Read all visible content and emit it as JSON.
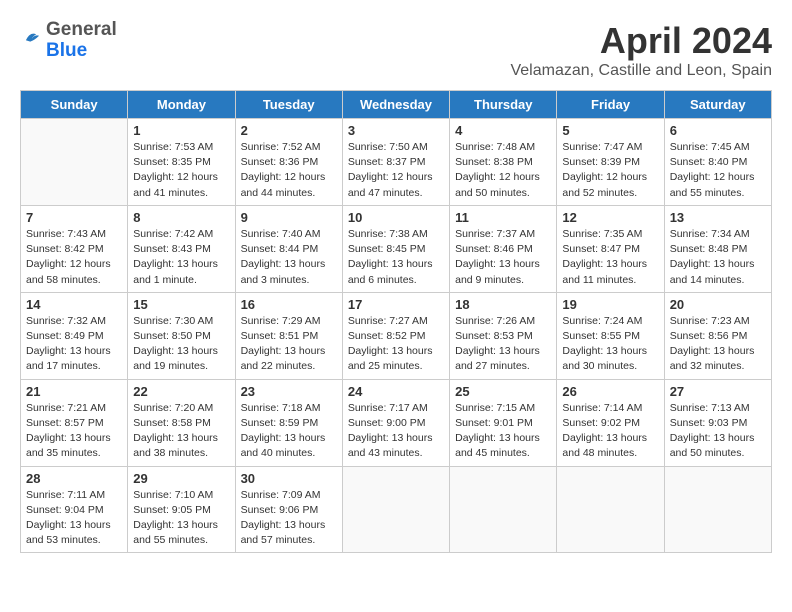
{
  "header": {
    "logo": {
      "general": "General",
      "blue": "Blue",
      "tagline": ""
    },
    "title": "April 2024",
    "subtitle": "Velamazan, Castille and Leon, Spain"
  },
  "calendar": {
    "weekdays": [
      "Sunday",
      "Monday",
      "Tuesday",
      "Wednesday",
      "Thursday",
      "Friday",
      "Saturday"
    ],
    "weeks": [
      [
        {
          "day": "",
          "info": ""
        },
        {
          "day": "1",
          "info": "Sunrise: 7:53 AM\nSunset: 8:35 PM\nDaylight: 12 hours\nand 41 minutes."
        },
        {
          "day": "2",
          "info": "Sunrise: 7:52 AM\nSunset: 8:36 PM\nDaylight: 12 hours\nand 44 minutes."
        },
        {
          "day": "3",
          "info": "Sunrise: 7:50 AM\nSunset: 8:37 PM\nDaylight: 12 hours\nand 47 minutes."
        },
        {
          "day": "4",
          "info": "Sunrise: 7:48 AM\nSunset: 8:38 PM\nDaylight: 12 hours\nand 50 minutes."
        },
        {
          "day": "5",
          "info": "Sunrise: 7:47 AM\nSunset: 8:39 PM\nDaylight: 12 hours\nand 52 minutes."
        },
        {
          "day": "6",
          "info": "Sunrise: 7:45 AM\nSunset: 8:40 PM\nDaylight: 12 hours\nand 55 minutes."
        }
      ],
      [
        {
          "day": "7",
          "info": "Sunrise: 7:43 AM\nSunset: 8:42 PM\nDaylight: 12 hours\nand 58 minutes."
        },
        {
          "day": "8",
          "info": "Sunrise: 7:42 AM\nSunset: 8:43 PM\nDaylight: 13 hours\nand 1 minute."
        },
        {
          "day": "9",
          "info": "Sunrise: 7:40 AM\nSunset: 8:44 PM\nDaylight: 13 hours\nand 3 minutes."
        },
        {
          "day": "10",
          "info": "Sunrise: 7:38 AM\nSunset: 8:45 PM\nDaylight: 13 hours\nand 6 minutes."
        },
        {
          "day": "11",
          "info": "Sunrise: 7:37 AM\nSunset: 8:46 PM\nDaylight: 13 hours\nand 9 minutes."
        },
        {
          "day": "12",
          "info": "Sunrise: 7:35 AM\nSunset: 8:47 PM\nDaylight: 13 hours\nand 11 minutes."
        },
        {
          "day": "13",
          "info": "Sunrise: 7:34 AM\nSunset: 8:48 PM\nDaylight: 13 hours\nand 14 minutes."
        }
      ],
      [
        {
          "day": "14",
          "info": "Sunrise: 7:32 AM\nSunset: 8:49 PM\nDaylight: 13 hours\nand 17 minutes."
        },
        {
          "day": "15",
          "info": "Sunrise: 7:30 AM\nSunset: 8:50 PM\nDaylight: 13 hours\nand 19 minutes."
        },
        {
          "day": "16",
          "info": "Sunrise: 7:29 AM\nSunset: 8:51 PM\nDaylight: 13 hours\nand 22 minutes."
        },
        {
          "day": "17",
          "info": "Sunrise: 7:27 AM\nSunset: 8:52 PM\nDaylight: 13 hours\nand 25 minutes."
        },
        {
          "day": "18",
          "info": "Sunrise: 7:26 AM\nSunset: 8:53 PM\nDaylight: 13 hours\nand 27 minutes."
        },
        {
          "day": "19",
          "info": "Sunrise: 7:24 AM\nSunset: 8:55 PM\nDaylight: 13 hours\nand 30 minutes."
        },
        {
          "day": "20",
          "info": "Sunrise: 7:23 AM\nSunset: 8:56 PM\nDaylight: 13 hours\nand 32 minutes."
        }
      ],
      [
        {
          "day": "21",
          "info": "Sunrise: 7:21 AM\nSunset: 8:57 PM\nDaylight: 13 hours\nand 35 minutes."
        },
        {
          "day": "22",
          "info": "Sunrise: 7:20 AM\nSunset: 8:58 PM\nDaylight: 13 hours\nand 38 minutes."
        },
        {
          "day": "23",
          "info": "Sunrise: 7:18 AM\nSunset: 8:59 PM\nDaylight: 13 hours\nand 40 minutes."
        },
        {
          "day": "24",
          "info": "Sunrise: 7:17 AM\nSunset: 9:00 PM\nDaylight: 13 hours\nand 43 minutes."
        },
        {
          "day": "25",
          "info": "Sunrise: 7:15 AM\nSunset: 9:01 PM\nDaylight: 13 hours\nand 45 minutes."
        },
        {
          "day": "26",
          "info": "Sunrise: 7:14 AM\nSunset: 9:02 PM\nDaylight: 13 hours\nand 48 minutes."
        },
        {
          "day": "27",
          "info": "Sunrise: 7:13 AM\nSunset: 9:03 PM\nDaylight: 13 hours\nand 50 minutes."
        }
      ],
      [
        {
          "day": "28",
          "info": "Sunrise: 7:11 AM\nSunset: 9:04 PM\nDaylight: 13 hours\nand 53 minutes."
        },
        {
          "day": "29",
          "info": "Sunrise: 7:10 AM\nSunset: 9:05 PM\nDaylight: 13 hours\nand 55 minutes."
        },
        {
          "day": "30",
          "info": "Sunrise: 7:09 AM\nSunset: 9:06 PM\nDaylight: 13 hours\nand 57 minutes."
        },
        {
          "day": "",
          "info": ""
        },
        {
          "day": "",
          "info": ""
        },
        {
          "day": "",
          "info": ""
        },
        {
          "day": "",
          "info": ""
        }
      ]
    ]
  }
}
